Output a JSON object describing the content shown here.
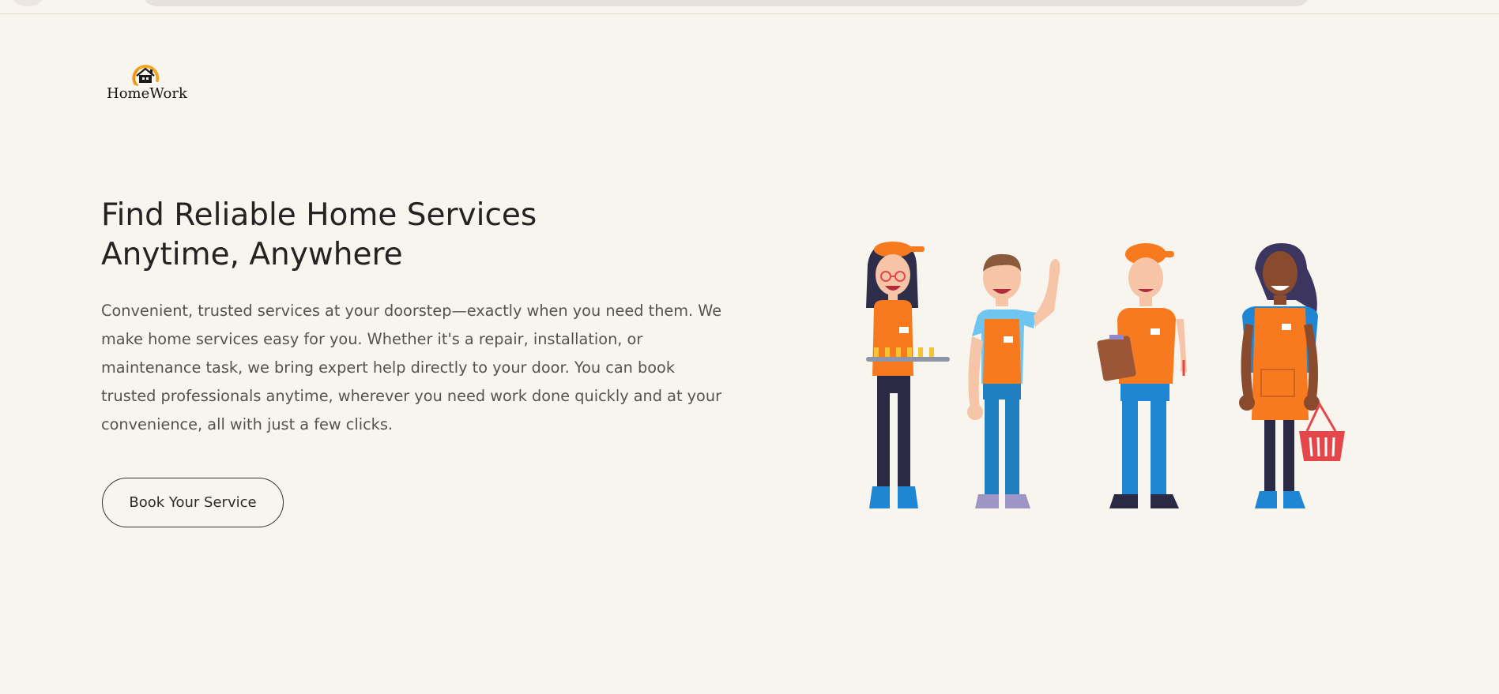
{
  "brand": {
    "name": "HomeWork",
    "accent": "#f5a623"
  },
  "hero": {
    "title_line1": "Find Reliable Home Services",
    "title_line2": "Anytime, Anywhere",
    "description": "Convenient, trusted services at your doorstep—exactly when you need them. We make home services easy for you. Whether it's a repair, installation, or maintenance task, we bring expert help directly to your door. You can book trusted professionals anytime, wherever you need work done quickly and at your convenience, all with just a few clicks.",
    "cta_label": "Book Your Service"
  },
  "colors": {
    "background": "#f8f4ee",
    "uniform_orange": "#f77a1f",
    "blue": "#1f86d3",
    "navy": "#2b2a45"
  },
  "illustration": {
    "icon": "service-workers-illustration",
    "figures": [
      "worker-with-tray",
      "worker-waving",
      "worker-with-clipboard",
      "worker-with-basket"
    ]
  }
}
